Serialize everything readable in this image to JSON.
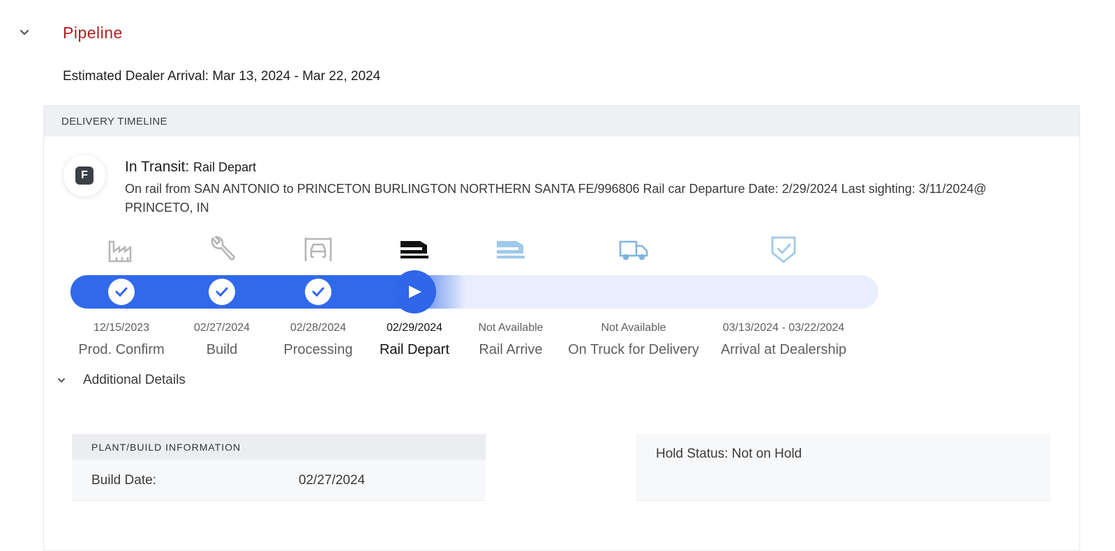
{
  "pipeline": {
    "title": "Pipeline",
    "eta_label": "Estimated Dealer Arrival: Mar 13, 2024 - Mar 22, 2024"
  },
  "timeline": {
    "header": "DELIVERY TIMELINE",
    "badge_letter": "F",
    "status_prefix": "In Transit:",
    "status_stage": "Rail Depart",
    "description": "On rail from SAN ANTONIO to PRINCETON BURLINGTON NORTHERN SANTA FE/996806 Rail car Departure Date: 2/29/2024 Last sighting: 3/11/2024@ PRINCETO, IN",
    "progress_fraction": 0.49,
    "stages": [
      {
        "label": "Prod. Confirm",
        "date": "12/15/2023",
        "state": "complete",
        "icon": "factory-icon"
      },
      {
        "label": "Build",
        "date": "02/27/2024",
        "state": "complete",
        "icon": "wrench-icon"
      },
      {
        "label": "Processing",
        "date": "02/28/2024",
        "state": "complete",
        "icon": "car-garage-icon"
      },
      {
        "label": "Rail Depart",
        "date": "02/29/2024",
        "state": "current",
        "icon": "rail-car-icon"
      },
      {
        "label": "Rail Arrive",
        "date": "Not Available",
        "state": "pending",
        "icon": "rail-car-icon"
      },
      {
        "label": "On Truck for Delivery",
        "date": "Not Available",
        "state": "pending",
        "icon": "truck-icon"
      },
      {
        "label": "Arrival at Dealership",
        "date": "03/13/2024 - 03/22/2024",
        "state": "pending",
        "icon": "shield-check-icon"
      }
    ]
  },
  "additional": {
    "title": "Additional Details",
    "plant_header": "PLANT/BUILD INFORMATION",
    "build_date_label": "Build Date:",
    "build_date_value": "02/27/2024",
    "hold_status": "Hold Status: Not on Hold"
  },
  "colors": {
    "accent_red": "#b31d1d",
    "progress_blue": "#3069ea",
    "pending_blue": "#9fc9ea",
    "complete_gray": "#b5b5b5"
  }
}
